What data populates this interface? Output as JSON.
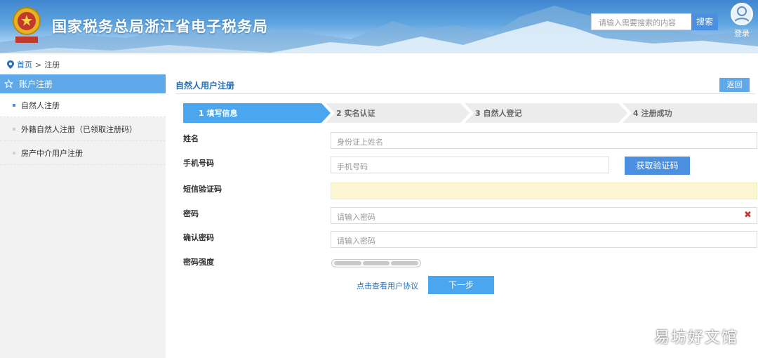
{
  "header": {
    "title": "国家税务总局浙江省电子税务局",
    "search_placeholder": "请输入需要搜索的内容",
    "search_button": "搜索",
    "login_label": "登录",
    "emblem_icon": "tax-emblem-icon"
  },
  "breadcrumb": {
    "home": "首页",
    "separator": ">",
    "current": "注册"
  },
  "sidebar": {
    "heading": "账户注册",
    "items": [
      {
        "label": "自然人注册",
        "active": true
      },
      {
        "label": "外籍自然人注册（已领取注册码）",
        "active": false
      },
      {
        "label": "房产中介用户注册",
        "active": false
      }
    ]
  },
  "main": {
    "title": "自然人用户注册",
    "back_button": "返回",
    "steps": [
      {
        "num": "1",
        "label": "填写信息",
        "active": true
      },
      {
        "num": "2",
        "label": "实名认证",
        "active": false
      },
      {
        "num": "3",
        "label": "自然人登记",
        "active": false
      },
      {
        "num": "4",
        "label": "注册成功",
        "active": false
      }
    ],
    "form": {
      "name_label": "姓名",
      "name_placeholder": "身份证上姓名",
      "phone_label": "手机号码",
      "phone_placeholder": "手机号码",
      "get_code_button": "获取验证码",
      "sms_label": "短信验证码",
      "password_label": "密码",
      "password_placeholder": "请输入密码",
      "confirm_label": "确认密码",
      "confirm_placeholder": "请输入密码",
      "strength_label": "密码强度",
      "clear_icon": "✖"
    },
    "agreement_link": "点击查看用户协议",
    "next_button": "下一步"
  },
  "watermark": "易坊好文馆",
  "colors": {
    "accent": "#4a8fe0",
    "active_step": "#4aa6ee",
    "sidebar_head": "#5fa8ea",
    "step_inactive": "#ececec"
  }
}
